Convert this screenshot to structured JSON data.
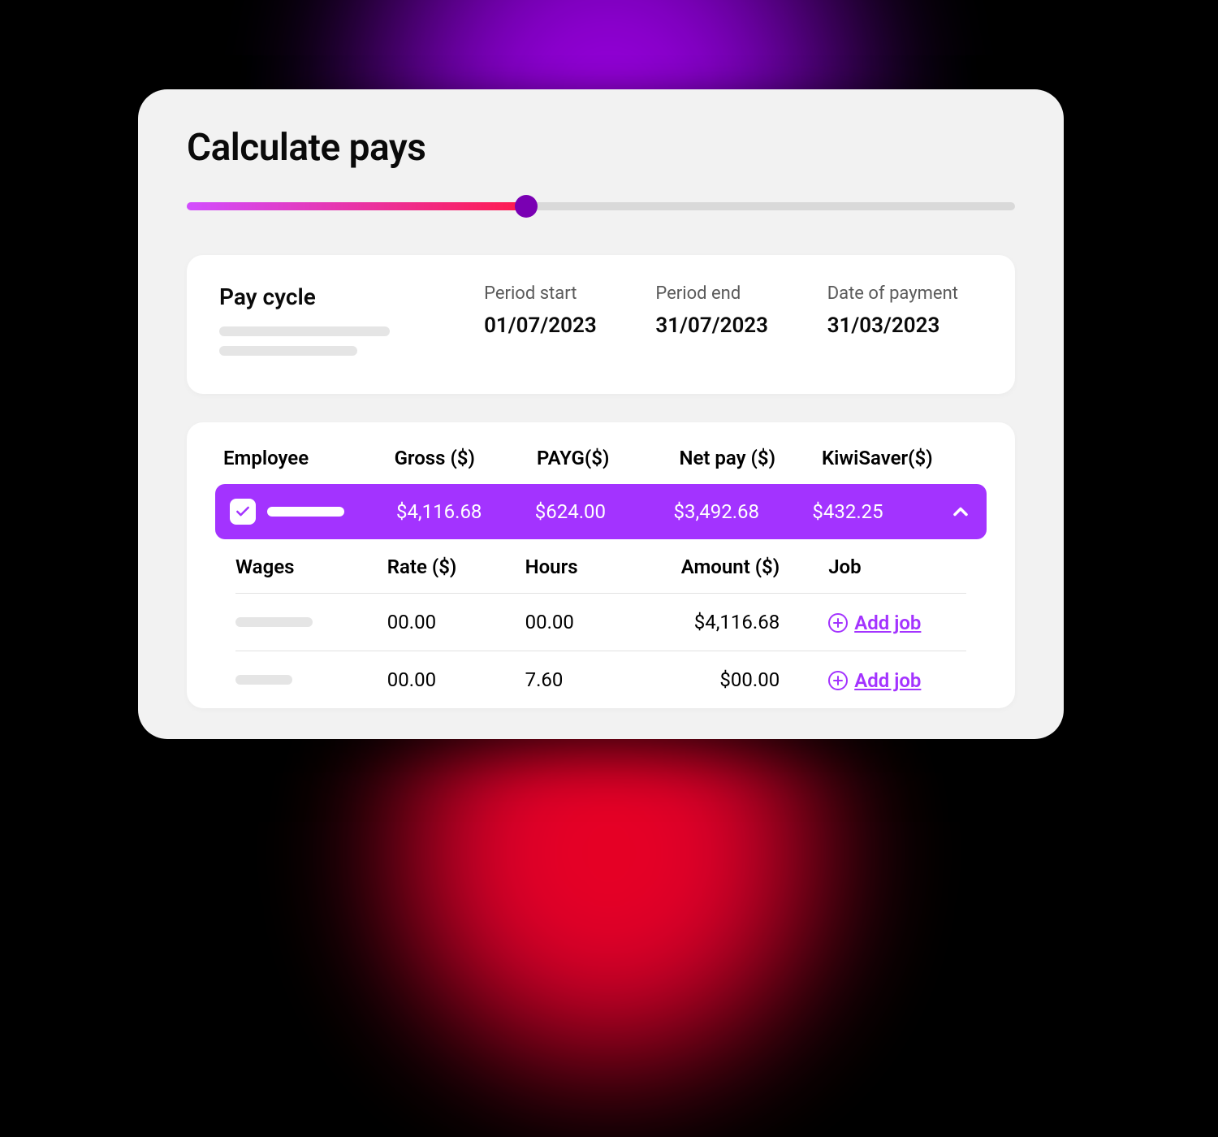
{
  "page": {
    "title": "Calculate pays"
  },
  "progress": {
    "percent": 41
  },
  "paycycle": {
    "title": "Pay cycle",
    "period_start_label": "Period start",
    "period_start": "01/07/2023",
    "period_end_label": "Period end",
    "period_end": "31/07/2023",
    "payment_date_label": "Date of payment",
    "payment_date": "31/03/2023"
  },
  "employees": {
    "headers": {
      "employee": "Employee",
      "gross": "Gross ($)",
      "payg": "PAYG($)",
      "net": "Net pay ($)",
      "kiwi": "KiwiSaver($)"
    },
    "row": {
      "checked": true,
      "gross": "$4,116.68",
      "payg": "$624.00",
      "net": "$3,492.68",
      "kiwi": "$432.25"
    }
  },
  "wages": {
    "headers": {
      "wages": "Wages",
      "rate": "Rate ($)",
      "hours": "Hours",
      "amount": "Amount ($)",
      "job": "Job"
    },
    "rows": [
      {
        "rate": "00.00",
        "hours": "00.00",
        "amount": "$4,116.68",
        "add_label": "Add job"
      },
      {
        "rate": "00.00",
        "hours": "7.60",
        "amount": "$00.00",
        "add_label": "Add job"
      }
    ]
  },
  "colors": {
    "accent": "#a333ff"
  }
}
